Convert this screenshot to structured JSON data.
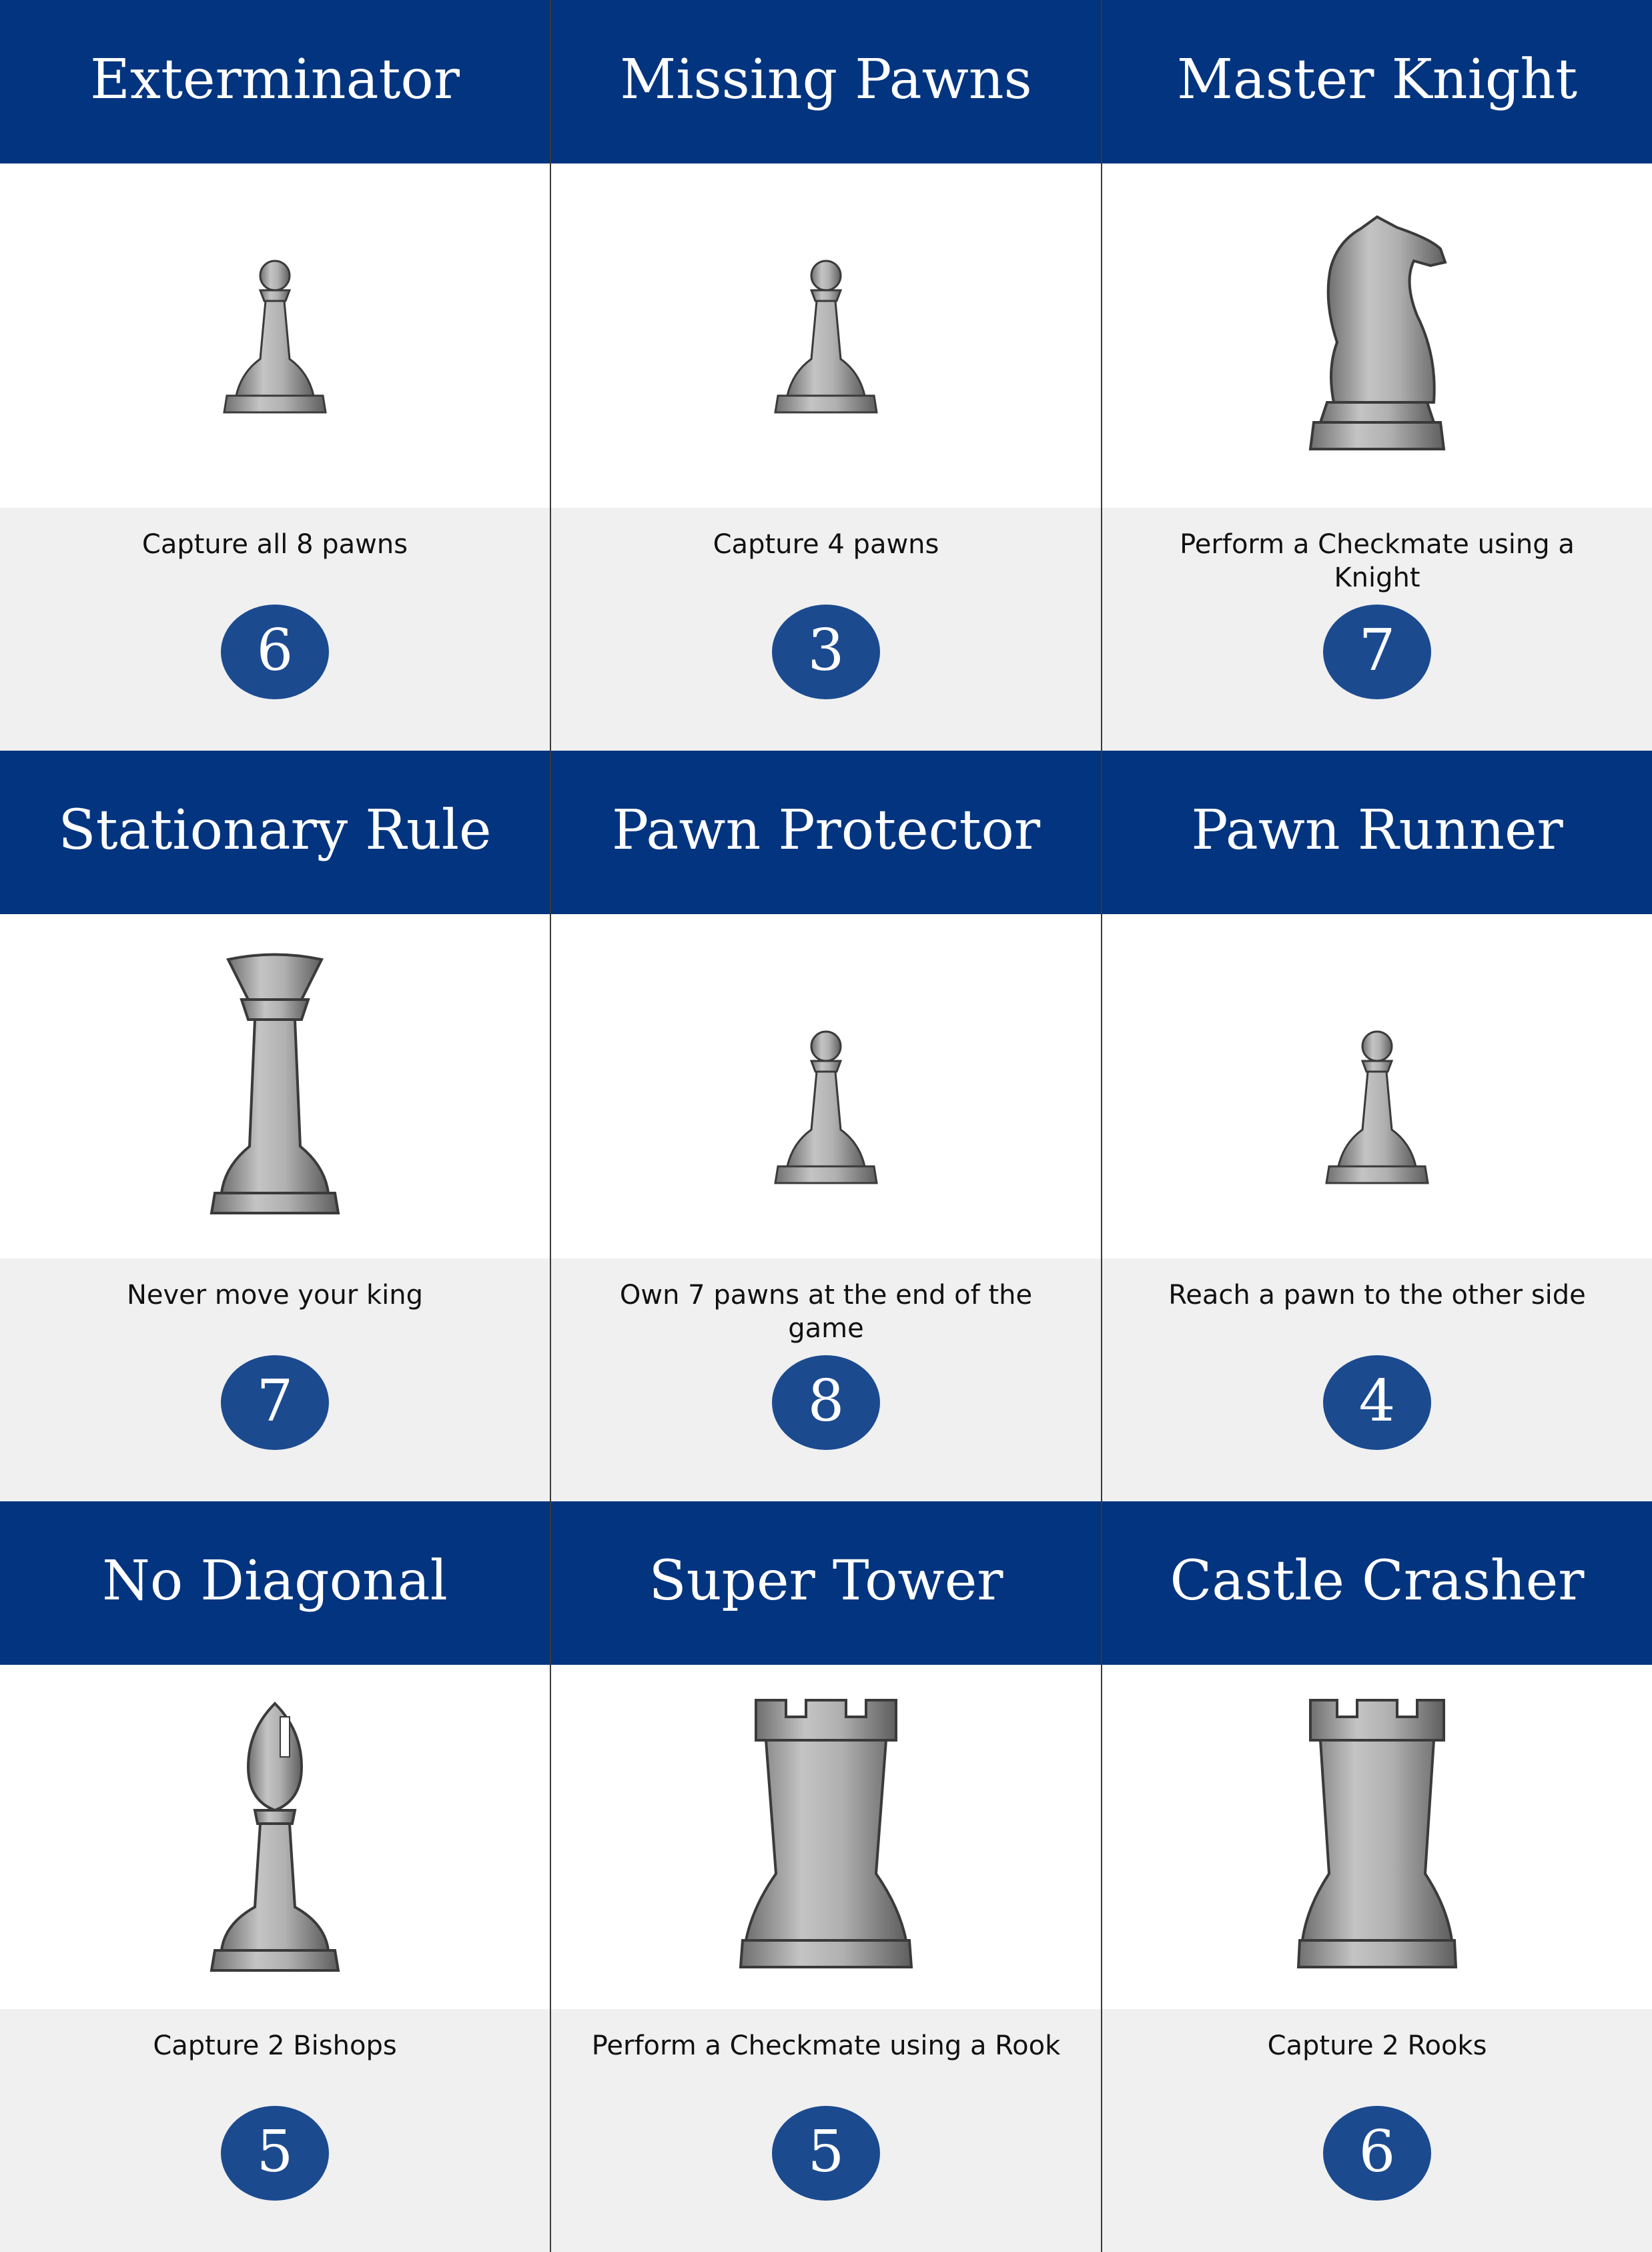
{
  "cards": [
    {
      "title": "Exterminator",
      "piece": "pawn",
      "piece_icon": "pawn-icon",
      "description": "Capture all 8 pawns",
      "points": "6"
    },
    {
      "title": "Missing Pawns",
      "piece": "pawn",
      "piece_icon": "pawn-icon",
      "description": "Capture 4 pawns",
      "points": "3"
    },
    {
      "title": "Master Knight",
      "piece": "knight",
      "piece_icon": "knight-icon",
      "description": "Perform a Checkmate using a Knight",
      "points": "7"
    },
    {
      "title": "Stationary Rule",
      "piece": "queen",
      "piece_icon": "queen-icon",
      "description": "Never move your king",
      "points": "7"
    },
    {
      "title": "Pawn Protector",
      "piece": "pawn",
      "piece_icon": "pawn-icon",
      "description": "Own 7 pawns at the end of the game",
      "points": "8"
    },
    {
      "title": "Pawn Runner",
      "piece": "pawn",
      "piece_icon": "pawn-icon",
      "description": "Reach a pawn to the other side",
      "points": "4"
    },
    {
      "title": "No Diagonal",
      "piece": "bishop",
      "piece_icon": "bishop-icon",
      "description": "Capture 2 Bishops",
      "points": "5"
    },
    {
      "title": "Super Tower",
      "piece": "rook",
      "piece_icon": "rook-icon",
      "description": "Perform a Checkmate using a Rook",
      "points": "5"
    },
    {
      "title": "Castle Crasher",
      "piece": "rook",
      "piece_icon": "rook-icon",
      "description": "Capture 2 Rooks",
      "points": "6"
    }
  ],
  "colors": {
    "header": "#02347f",
    "badge": "#1b4a8f",
    "footer": "#f0f0f0",
    "piece": "#a9a9a9"
  }
}
